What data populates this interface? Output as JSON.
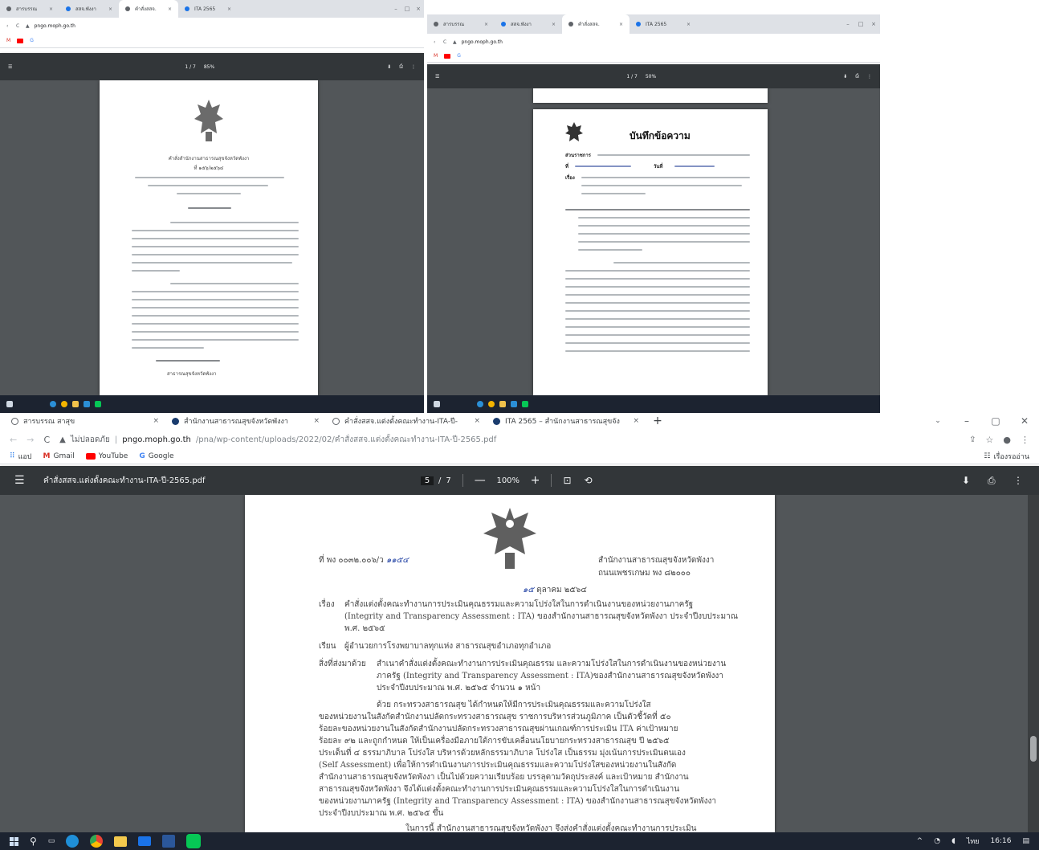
{
  "main": {
    "tabs": [
      {
        "label": "สารบรรณ สาสุข",
        "active": false
      },
      {
        "label": "สำนักงานสาธารณสุขจังหวัดพังงา",
        "active": false
      },
      {
        "label": "คำสั่งสสจ.แต่งตั้งคณะทำงาน-ITA-ปี-",
        "active": true
      },
      {
        "label": "ITA 2565 – สำนักงานสาธารณสุขจัง",
        "active": false
      }
    ],
    "new_tab": "+",
    "address": {
      "security": "ไม่ปลอดภัย",
      "host": "pngo.moph.go.th",
      "path": "/pna/wp-content/uploads/2022/02/คำสั่งสสจ.แต่งตั้งคณะทำงาน-ITA-ปี-2565.pdf"
    },
    "bookmarks": [
      {
        "label": "แอป",
        "icon": "apps-grid-icon"
      },
      {
        "label": "Gmail",
        "icon": "gmail-icon"
      },
      {
        "label": "YouTube",
        "icon": "youtube-icon"
      },
      {
        "label": "Google",
        "icon": "google-icon"
      }
    ],
    "reading_list": "เรื่องรออ่าน",
    "pdf": {
      "filename": "คำสั่งสสจ.แต่งตั้งคณะทำงาน-ITA-ปี-2565.pdf",
      "page_current": "5",
      "page_sep": "/",
      "page_total": "7",
      "zoom": "100%"
    },
    "document": {
      "ref": "ที่ พง ๐๐๓๒.๐๐๖/ว",
      "ref_hand": "๑๑๕๔",
      "org_line1": "สำนักงานสาธารณสุขจังหวัดพังงา",
      "org_line2": "ถนนเพชรเกษม พง ๘๒๐๐๐",
      "date_hand": "๑๕",
      "date_text": "ตุลาคม ๒๕๖๔",
      "subject_label": "เรื่อง",
      "subject_l1": "คำสั่งแต่งตั้งคณะทำงานการประเมินคุณธรรมและความโปร่งใสในการดำเนินงานของหน่วยงานภาครัฐ",
      "subject_l2": "(Integrity and Transparency Assessment : ITA) ของสำนักงานสาธารณสุขจังหวัดพังงา ประจำปีงบประมาณ",
      "subject_l3": "พ.ศ. ๒๕๖๕",
      "to_label": "เรียน",
      "to_text": "ผู้อำนวยการโรงพยาบาลทุกแห่ง สาธารณสุขอำเภอทุกอำเภอ",
      "att_label": "สิ่งที่ส่งมาด้วย",
      "att_l1": "สำเนาคำสั่งแต่งตั้งคณะทำงานการประเมินคุณธรรม และความโปร่งใสในการดำเนินงานของหน่วยงาน",
      "att_l2": "ภาครัฐ (Integrity and Transparency Assessment : ITA)ของสำนักงานสาธารณสุขจังหวัดพังงา",
      "att_l3": "ประจำปีงบประมาณ พ.ศ. ๒๕๖๕ จำนวน ๑ หน้า",
      "body_l1": "ด้วย กระทรวงสาธารณสุข ได้กำหนดให้มีการประเมินคุณธรรมและความโปร่งใส",
      "body_l2": "ของหน่วยงานในสังกัดสำนักงานปลัดกระทรวงสาธารณสุข ราชการบริหารส่วนภูมิภาค เป็นตัวชี้วัดที่ ๕๐",
      "body_l3": "ร้อยละของหน่วยงานในสังกัดสำนักงานปลัดกระทรวงสาธารณสุขผ่านเกณฑ์การประเมิน ITA ค่าเป้าหมาย",
      "body_l4": "ร้อยละ ๙๒ และถูกกำหนด ให้เป็นเครื่องมือภายใต้การขับเคลื่อนนโยบายกระทรวงสาธารณสุข ปี ๒๕๖๕",
      "body_l5": "ประเด็นที่ ๔ ธรรมาภิบาล โปร่งใส บริหารด้วยหลักธรรมาภิบาล โปร่งใส เป็นธรรม มุ่งเน้นการประเมินตนเอง",
      "body_l6": "(Self Assessment) เพื่อให้การดำเนินงานการประเมินคุณธรรมและความโปร่งใสของหน่วยงานในสังกัด",
      "body_l7": "สำนักงานสาธารณสุขจังหวัดพังงา เป็นไปด้วยความเรียบร้อย บรรลุตามวัตถุประสงค์ และเป้าหมาย สำนักงาน",
      "body_l8": "สาธารณสุขจังหวัดพังงา จึงได้แต่งตั้งคณะทำงานการประเมินคุณธรรมและความโปร่งใสในการดำเนินงาน",
      "body_l9": "ของหน่วยงานภาครัฐ (Integrity and Transparency Assessment : ITA) ของสำนักงานสาธารณสุขจังหวัดพังงา",
      "body_l10": "ประจำปีงบประมาณ พ.ศ. ๒๕๖๕ ขึ้น",
      "body_l11": "ในการนี้ สำนักงานสาธารณสุขจังหวัดพังงา จึงส่งคำสั่งแต่งตั้งคณะทำงานการประเมิน"
    },
    "taskbar": {
      "clock": "16:16",
      "lang": "ไทย"
    }
  },
  "top_left": {
    "pdf_page": "1 / 7",
    "zoom": "85%",
    "order_title": "คำสั่งสำนักงานสาธารณสุขจังหวัดพังงา",
    "order_no": "ที่ ๑๕๖/๒๕๖๔",
    "footer_label": "สาธารณสุขจังหวัดพังงา"
  },
  "top_right": {
    "memo_title": "บันทึกข้อความ",
    "org_label": "ส่วนราชการ",
    "ref_label": "ที่",
    "date_label": "วันที่",
    "subject_label": "เรื่อง",
    "pdf_page": "1 / 7",
    "zoom": "50%"
  },
  "colors": {
    "pdf_toolbar": "#323639",
    "pdf_bg": "#525659",
    "taskbar": "#1c2330",
    "tab_bar": "#dee1e6"
  }
}
